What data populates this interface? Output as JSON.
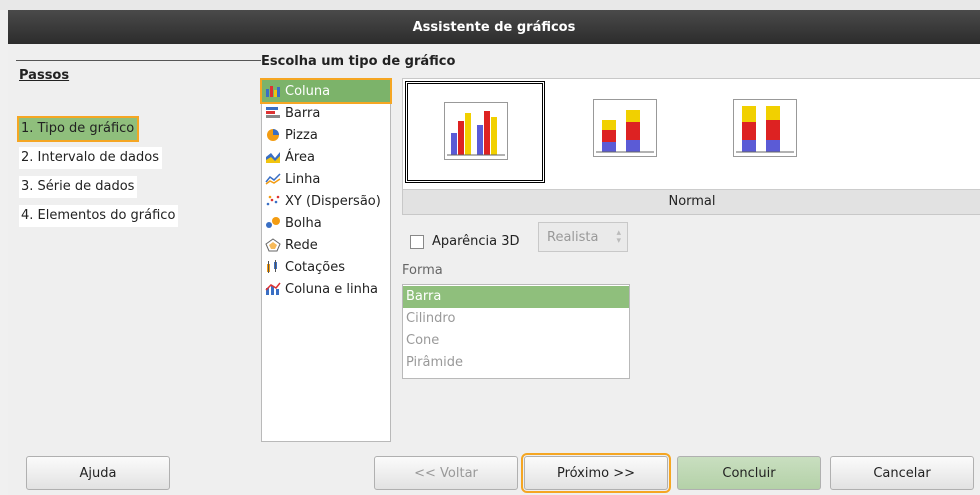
{
  "window": {
    "title": "Assistente de gráficos"
  },
  "steps": {
    "title": "Passos",
    "items": [
      {
        "label": "1. Tipo de gráfico"
      },
      {
        "label": "2. Intervalo de dados"
      },
      {
        "label": "3. Série de dados"
      },
      {
        "label": "4. Elementos do gráfico"
      }
    ]
  },
  "chart_type": {
    "title": "Escolha um tipo de gráfico",
    "items": [
      {
        "label": "Coluna",
        "icon": "column-chart-icon"
      },
      {
        "label": "Barra",
        "icon": "bar-chart-icon"
      },
      {
        "label": "Pizza",
        "icon": "pie-chart-icon"
      },
      {
        "label": "Área",
        "icon": "area-chart-icon"
      },
      {
        "label": "Linha",
        "icon": "line-chart-icon"
      },
      {
        "label": "XY (Dispersão)",
        "icon": "scatter-chart-icon"
      },
      {
        "label": "Bolha",
        "icon": "bubble-chart-icon"
      },
      {
        "label": "Rede",
        "icon": "net-chart-icon"
      },
      {
        "label": "Cotações",
        "icon": "stock-chart-icon"
      },
      {
        "label": "Coluna e linha",
        "icon": "column-line-chart-icon"
      }
    ],
    "selected": "Coluna"
  },
  "variants": {
    "selected_label": "Normal"
  },
  "appearance3d": {
    "label": "Aparência 3D",
    "checked": false,
    "style_value": "Realista"
  },
  "shape": {
    "title": "Forma",
    "items": [
      {
        "label": "Barra"
      },
      {
        "label": "Cilindro"
      },
      {
        "label": "Cone"
      },
      {
        "label": "Pirâmide"
      }
    ],
    "selected": "Barra"
  },
  "buttons": {
    "help": "Ajuda",
    "back": "<< Voltar",
    "next": "Próximo >>",
    "finish": "Concluir",
    "cancel": "Cancelar"
  },
  "colors": {
    "selection": "#8fbf7c",
    "highlight": "#f5a623",
    "titlebar": "#3a3a3a"
  }
}
